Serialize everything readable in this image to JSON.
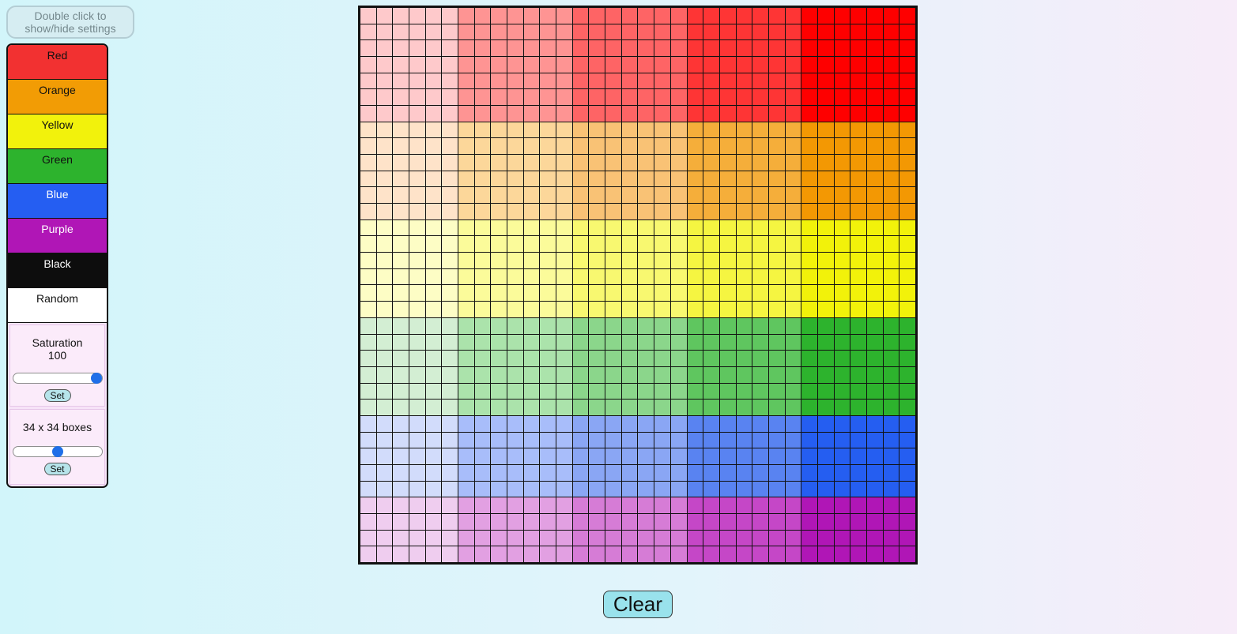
{
  "settings_toggle": {
    "label": "Double click to show/hide settings"
  },
  "colors": [
    {
      "label": "Red",
      "bg": "#f23131",
      "fg": "#111111"
    },
    {
      "label": "Orange",
      "bg": "#f29c05",
      "fg": "#111111"
    },
    {
      "label": "Yellow",
      "bg": "#f2f20c",
      "fg": "#111111"
    },
    {
      "label": "Green",
      "bg": "#2db32d",
      "fg": "#111111"
    },
    {
      "label": "Blue",
      "bg": "#255ef2",
      "fg": "#ffffff"
    },
    {
      "label": "Purple",
      "bg": "#b016b6",
      "fg": "#ffffff"
    },
    {
      "label": "Black",
      "bg": "#0d0d0d",
      "fg": "#ffffff"
    },
    {
      "label": "Random",
      "bg": "#ffffff",
      "fg": "#111111"
    }
  ],
  "saturation": {
    "label": "Saturation",
    "value": "100",
    "level": 1.0,
    "button": "Set"
  },
  "grid_size": {
    "label": "34 x 34 boxes",
    "level": 0.5,
    "button": "Set",
    "count": 34
  },
  "grid_colors": {
    "rows": [
      {
        "count": 7,
        "shades": [
          "#fec9cb",
          "#fe9493",
          "#fe6465",
          "#fe3535",
          "#fe0000"
        ]
      },
      {
        "count": 6,
        "shades": [
          "#fee3c9",
          "#fcd79a",
          "#f9c275",
          "#f5ae3a",
          "#f39803"
        ]
      },
      {
        "count": 6,
        "shades": [
          "#fdfdc5",
          "#fbfb9a",
          "#f8f870",
          "#f5f541",
          "#f2f20a"
        ]
      },
      {
        "count": 6,
        "shades": [
          "#d3eed3",
          "#abe3ab",
          "#8bd68b",
          "#5fc65f",
          "#2db32d"
        ]
      },
      {
        "count": 5,
        "shades": [
          "#d2dcfb",
          "#a8bdfa",
          "#8aa6f4",
          "#5983f1",
          "#255ef1"
        ]
      },
      {
        "count": 4,
        "shades": [
          "#efcdef",
          "#e2a0e2",
          "#d67cd6",
          "#c547c7",
          "#b016b6"
        ]
      }
    ],
    "column_bands": [
      6,
      7,
      7,
      7,
      7
    ]
  },
  "clear": {
    "label": "Clear"
  }
}
